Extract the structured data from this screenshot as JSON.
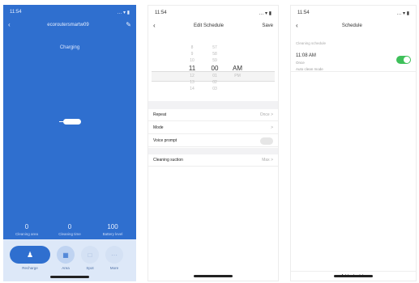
{
  "status": {
    "time": "11:54",
    "signal": "… ▾ ▮"
  },
  "screen1": {
    "device_name": "ecoroutersmartw09",
    "charging_label": "Charging",
    "stats": [
      {
        "value": "0",
        "label": "Cleaning area"
      },
      {
        "value": "0",
        "label": "Cleaning time"
      },
      {
        "value": "100",
        "label": "Battery level"
      }
    ],
    "actions": [
      {
        "icon": "♟",
        "label": "Recharge"
      },
      {
        "icon": "▦",
        "label": "Area"
      },
      {
        "icon": "□",
        "label": "Spot"
      },
      {
        "icon": "⋯",
        "label": "More"
      }
    ]
  },
  "screen2": {
    "title": "Edit Schedule",
    "save_label": "Save",
    "hours": [
      "8",
      "9",
      "10",
      "11",
      "12",
      "13",
      "14"
    ],
    "minutes": [
      "57",
      "58",
      "59",
      "00",
      "01",
      "02",
      "03"
    ],
    "ampm": [
      "",
      "",
      "",
      "AM",
      "PM",
      "",
      ""
    ],
    "rows": [
      {
        "label": "Repeat",
        "value": "Once >"
      },
      {
        "label": "Mode",
        "value": ">"
      },
      {
        "label": "Voice prompt",
        "value": ""
      },
      {
        "label": "Cleaning suction",
        "value": "Max >"
      }
    ]
  },
  "screen3": {
    "title": "Schedule",
    "section_label": "Cleaning schedule",
    "item": {
      "time": "11:08 AM",
      "sub1": "Once",
      "sub2": "Auto clean mode"
    },
    "bottom_label": "Add schedule"
  },
  "colors": {
    "accent": "#2f6fcf",
    "toggle_on": "#3ec05a"
  }
}
